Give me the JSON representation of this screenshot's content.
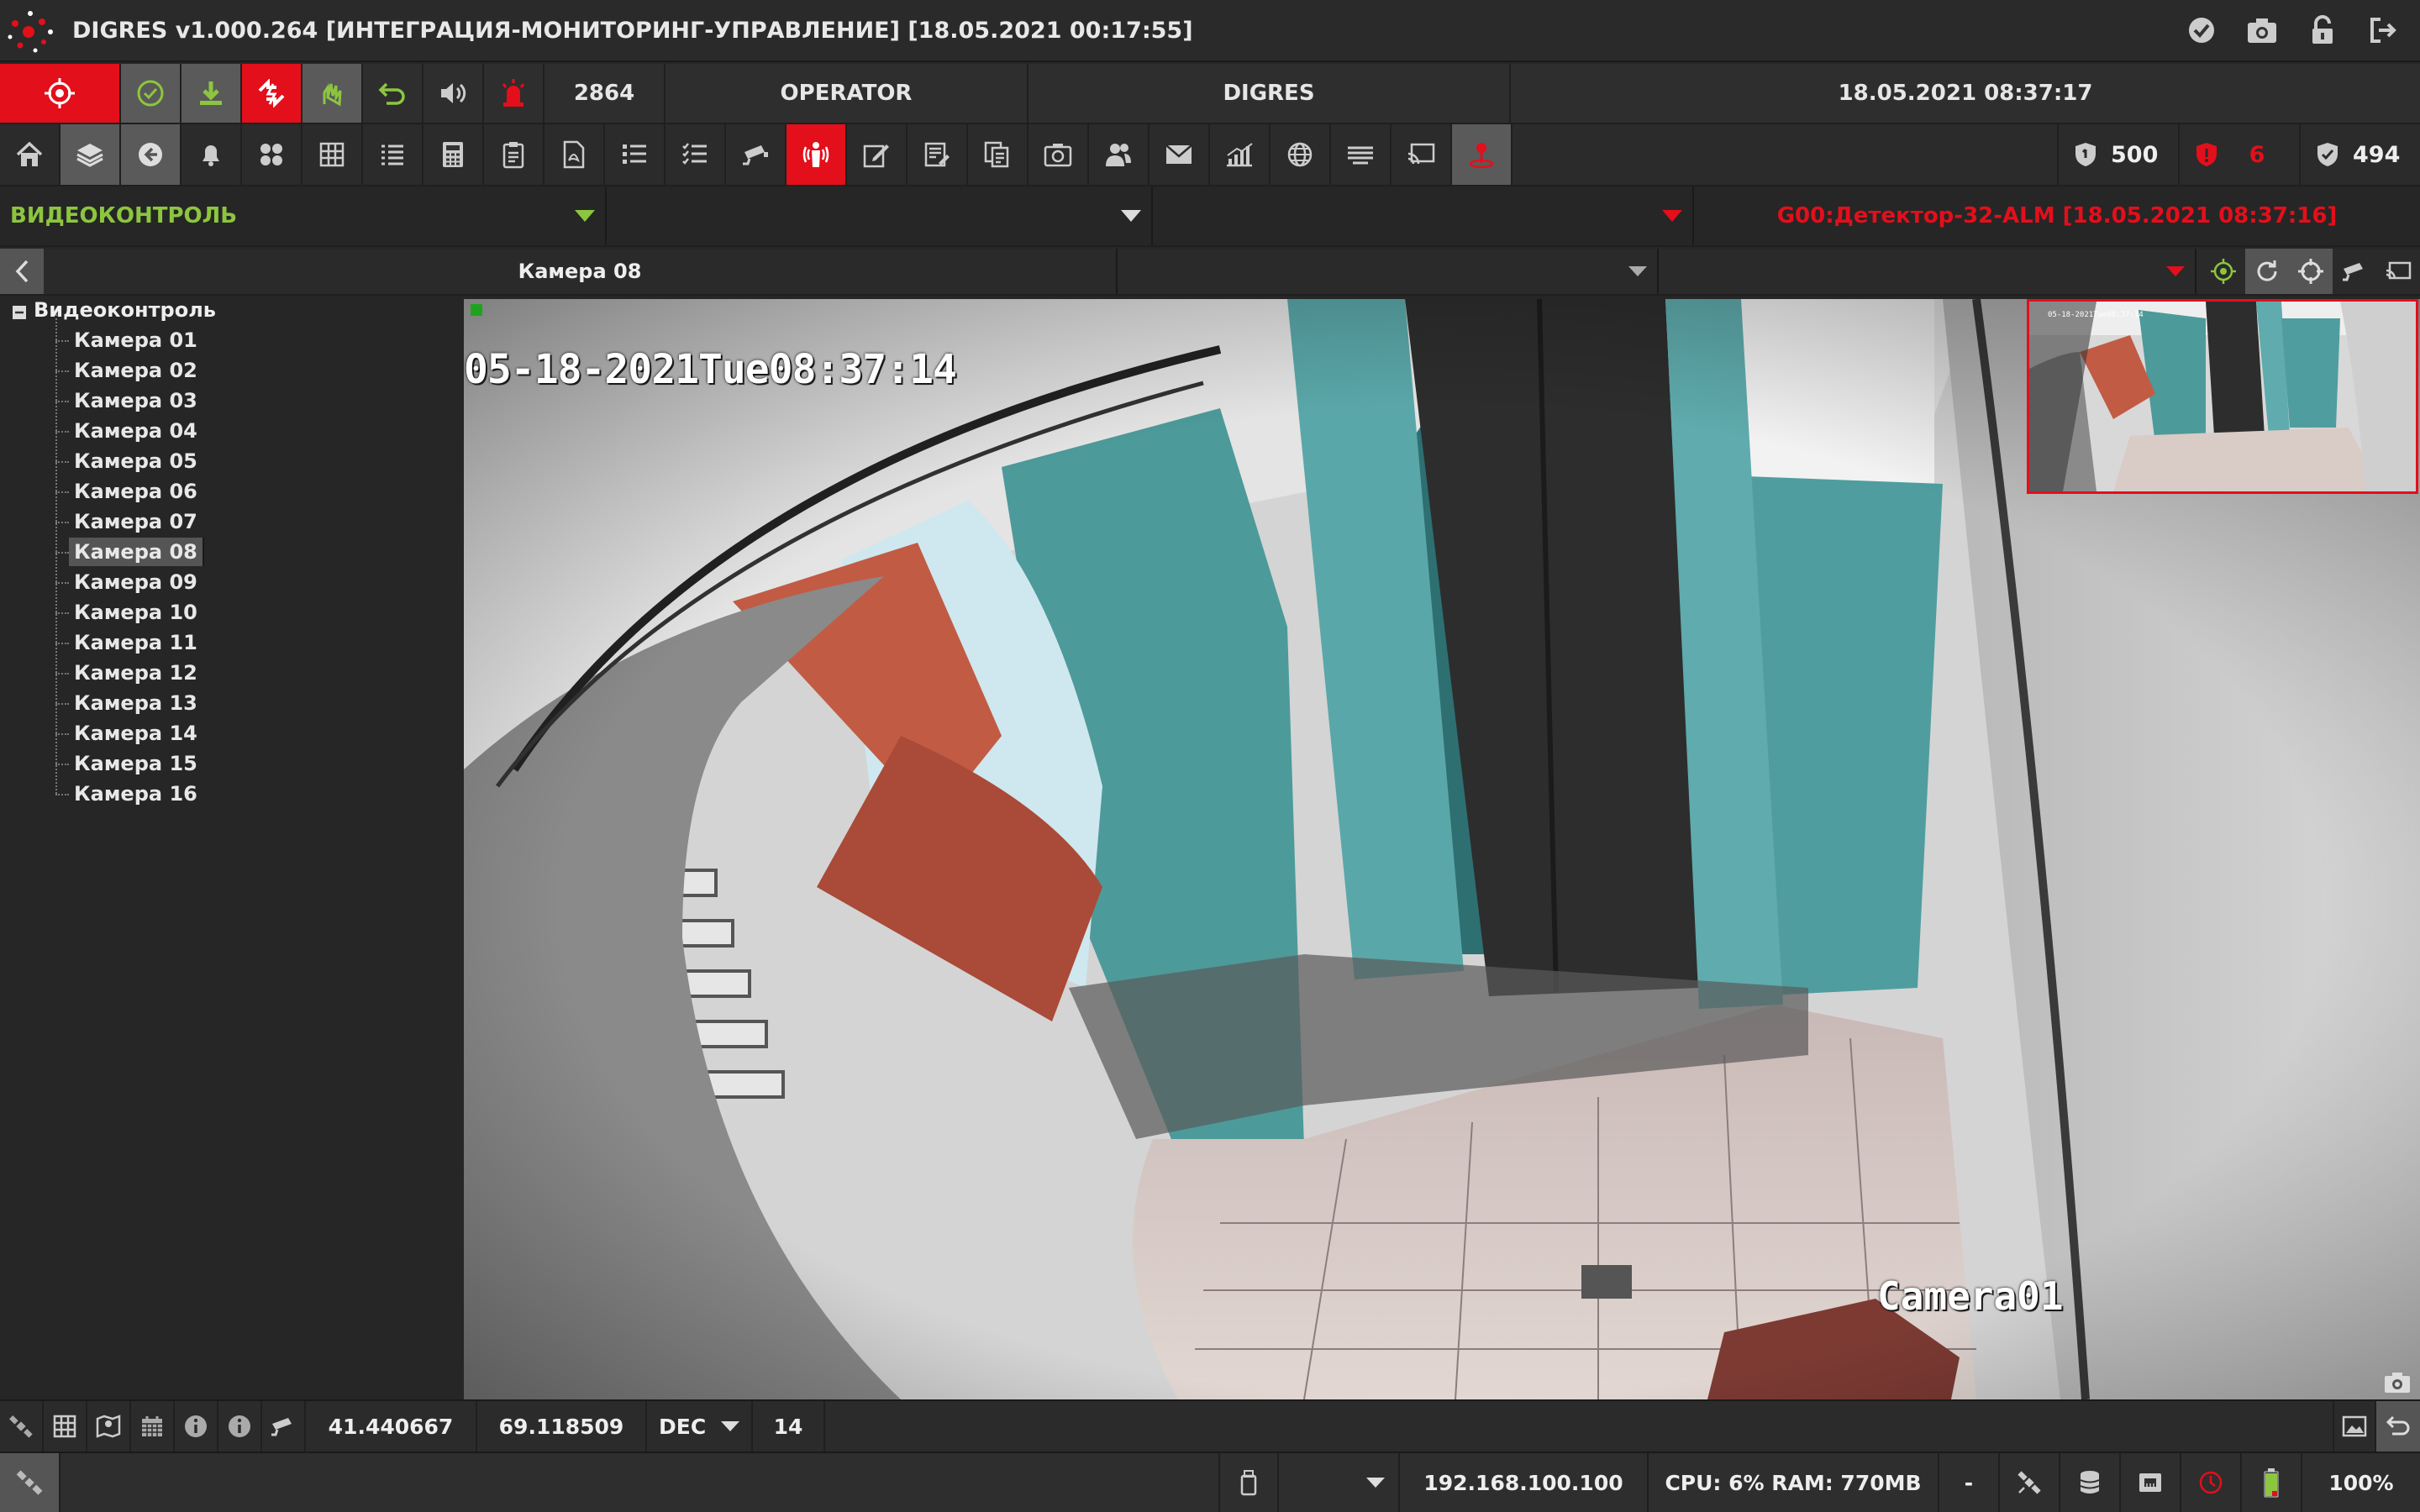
{
  "titlebar": {
    "title": "DIGRES v1.000.264 [ИНТЕГРАЦИЯ-МОНИТОРИНГ-УПРАВЛЕНИЕ] [18.05.2021 00:17:55]"
  },
  "statusrow": {
    "event_count": "2864",
    "user": "OPERATOR",
    "system": "DIGRES",
    "datetime": "18.05.2021 08:37:17"
  },
  "counters": {
    "total": "500",
    "alarms": "6",
    "ok": "494"
  },
  "selectors": {
    "section": "ВИДЕОКОНТРОЛЬ",
    "subsection": "",
    "filter": "",
    "alarm_message": "G00:Детектор-32-ALM [18.05.2021 08:37:16]"
  },
  "camera_header": {
    "camera_name": "Камера 08",
    "view_select": "",
    "layout_select": ""
  },
  "tree": {
    "root": "Видеоконтроль",
    "selected_index": 7,
    "items": [
      "Камера 01",
      "Камера 02",
      "Камера 03",
      "Камера 04",
      "Камера 05",
      "Камера 06",
      "Камера 07",
      "Камера 08",
      "Камера 09",
      "Камера 10",
      "Камера 11",
      "Камера 12",
      "Камера 13",
      "Камера 14",
      "Камера 15",
      "Камера 16"
    ]
  },
  "video": {
    "osd_timestamp": "05-18-2021Tue08:37:14",
    "osd_camera": "Camera01"
  },
  "coordbar": {
    "lat": "41.440667",
    "lon": "69.118509",
    "format": "DEC",
    "zoom": "14"
  },
  "footbar": {
    "device_select": "",
    "ip": "192.168.100.100",
    "resources": "CPU: 6% RAM: 770MB",
    "dash": "-",
    "battery": "100%"
  },
  "colors": {
    "red": "#e30f1b",
    "green": "#8cc63f",
    "active_gray": "#5a5a5a"
  }
}
